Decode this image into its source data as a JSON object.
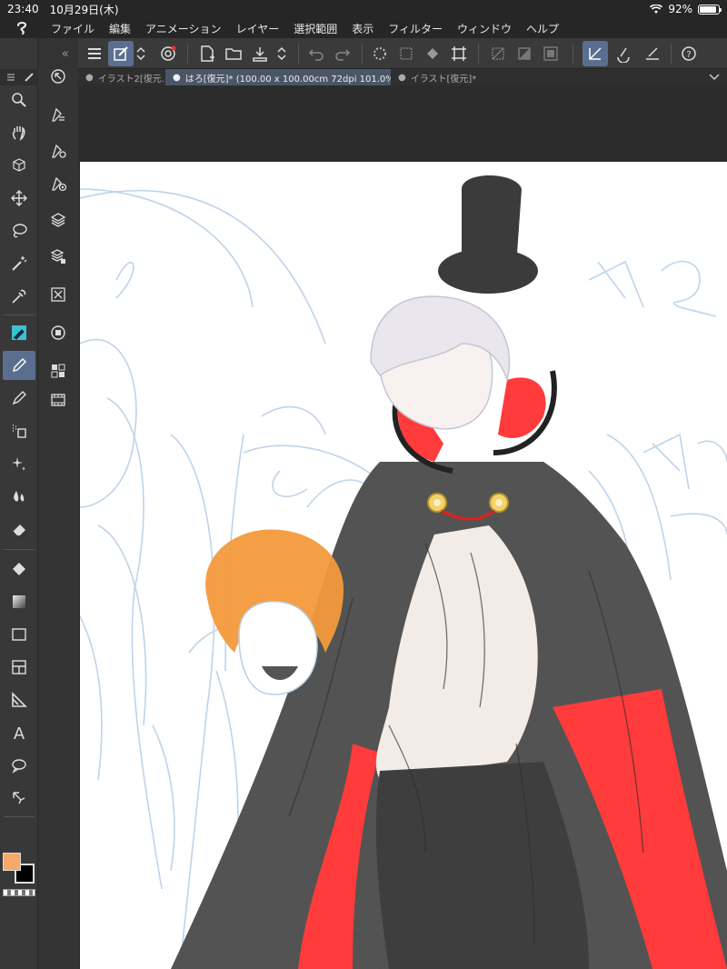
{
  "status": {
    "time": "23:40",
    "date": "10月29日(木)",
    "battery": "92%",
    "battery_level": 0.92
  },
  "menu": {
    "items": [
      "ファイル",
      "編集",
      "アニメーション",
      "レイヤー",
      "選択範囲",
      "表示",
      "フィルター",
      "ウィンドウ",
      "ヘルプ"
    ]
  },
  "tabs": [
    {
      "label": "イラスト2[復元...",
      "active": false
    },
    {
      "label": "はろ[復元]* (100.00 x 100.00cm 72dpi 101.0%)",
      "active": true
    },
    {
      "label": "イラスト[復元]*",
      "active": false
    }
  ],
  "toolbar": {
    "collapse_left": "«",
    "collapse_right": "«"
  },
  "colors": {
    "main": "#f5a96a",
    "sub": "#000000",
    "accent": "#5a6f8f",
    "cape": "#4a4a4a",
    "lining": "#ff3b3b",
    "hair": "#f39a3c"
  },
  "tools": [
    "menu-icon",
    "zoom-icon",
    "hand-icon",
    "object-icon",
    "move-icon",
    "lasso-icon",
    "magic-wand-icon",
    "eyedropper-icon",
    "pen-icon",
    "pencil-icon",
    "brush-icon",
    "airbrush-icon",
    "decoration-icon",
    "blend-icon",
    "eraser-icon",
    "fill-icon",
    "gradient-icon",
    "shape-icon",
    "frame-icon",
    "ruler-icon",
    "text-icon",
    "balloon-icon",
    "line-correction-icon"
  ],
  "subtools": [
    "navigator-icon",
    "tool-property-icon",
    "tool-settings-icon",
    "brush-size-icon",
    "layer-icon",
    "layer-property-icon",
    "material-icon",
    "color-icon",
    "sub-view-icon",
    "timeline-icon"
  ]
}
